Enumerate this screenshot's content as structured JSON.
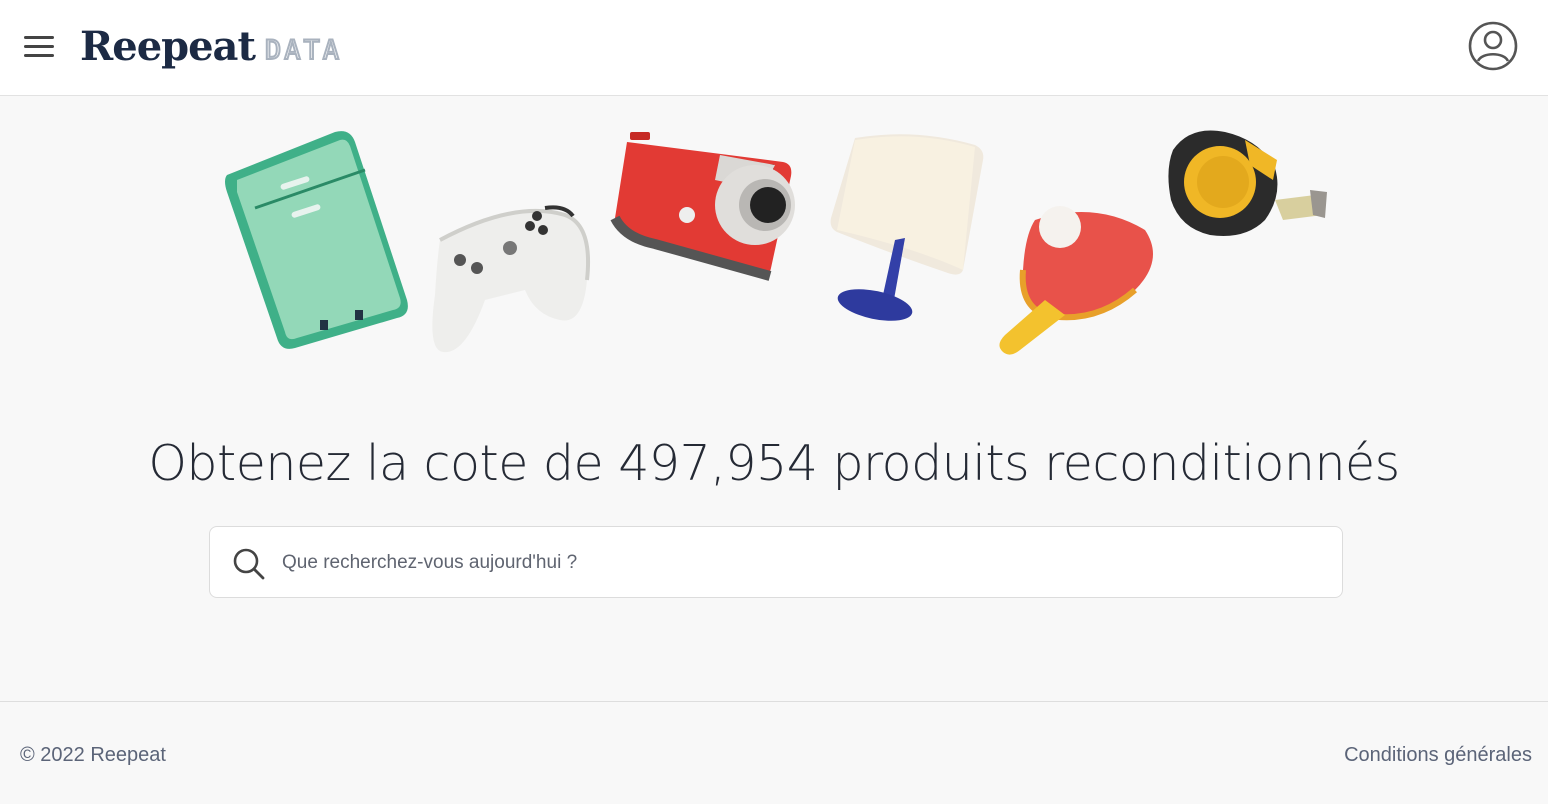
{
  "header": {
    "logo_word": "Reepeat",
    "logo_sub": "DATA",
    "menu_icon": "hamburger-menu-icon",
    "account_icon": "user-circle-icon"
  },
  "hero": {
    "illustrations": [
      "refrigerator",
      "game-controller",
      "camera",
      "table-lamp",
      "ping-pong-paddle",
      "tape-measure"
    ]
  },
  "main": {
    "headline": "Obtenez la cote de 497,954 produits reconditionnés"
  },
  "search": {
    "placeholder": "Que recherchez-vous aujourd'hui ?",
    "value": "",
    "icon": "search-icon"
  },
  "footer": {
    "copyright": "© 2022 Reepeat",
    "terms_link": "Conditions générales"
  },
  "colors": {
    "brand_navy": "#1c2a44",
    "background": "#f8f8f8",
    "footer_text": "#5b6478"
  }
}
